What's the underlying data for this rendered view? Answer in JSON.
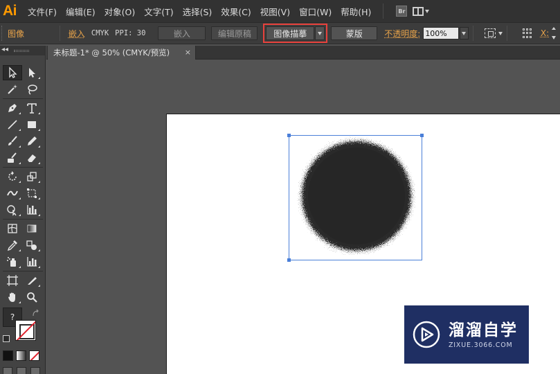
{
  "app": {
    "logo": "Ai"
  },
  "menubar": {
    "items": [
      "文件(F)",
      "编辑(E)",
      "对象(O)",
      "文字(T)",
      "选择(S)",
      "效果(C)",
      "视图(V)",
      "窗口(W)",
      "帮助(H)"
    ],
    "bridge_label": "Br"
  },
  "controlbar": {
    "object_type": "图像",
    "embed_status": "嵌入",
    "color_mode": "CMYK",
    "ppi_label": "PPI: 30",
    "embed_button": "嵌入",
    "edit_original_button": "编辑原稿",
    "image_trace_button": "图像描摹",
    "mask_button": "蒙版",
    "opacity_label": "不透明度:",
    "opacity_value": "100%",
    "x_label": "X:"
  },
  "document": {
    "tab_title": "未标题-1* @ 50% (CMYK/预览)",
    "close_glyph": "×"
  },
  "tools": {
    "header_glyph": "◂◂",
    "fill_label": "?"
  },
  "watermark": {
    "title": "溜溜自学",
    "url": "ZIXUE.3066.COM"
  },
  "colors": {
    "accent_orange": "#e8a34a",
    "highlight_red": "#e8413c",
    "selection_blue": "#4a7fd8",
    "watermark_bg": "#1f2f63"
  }
}
